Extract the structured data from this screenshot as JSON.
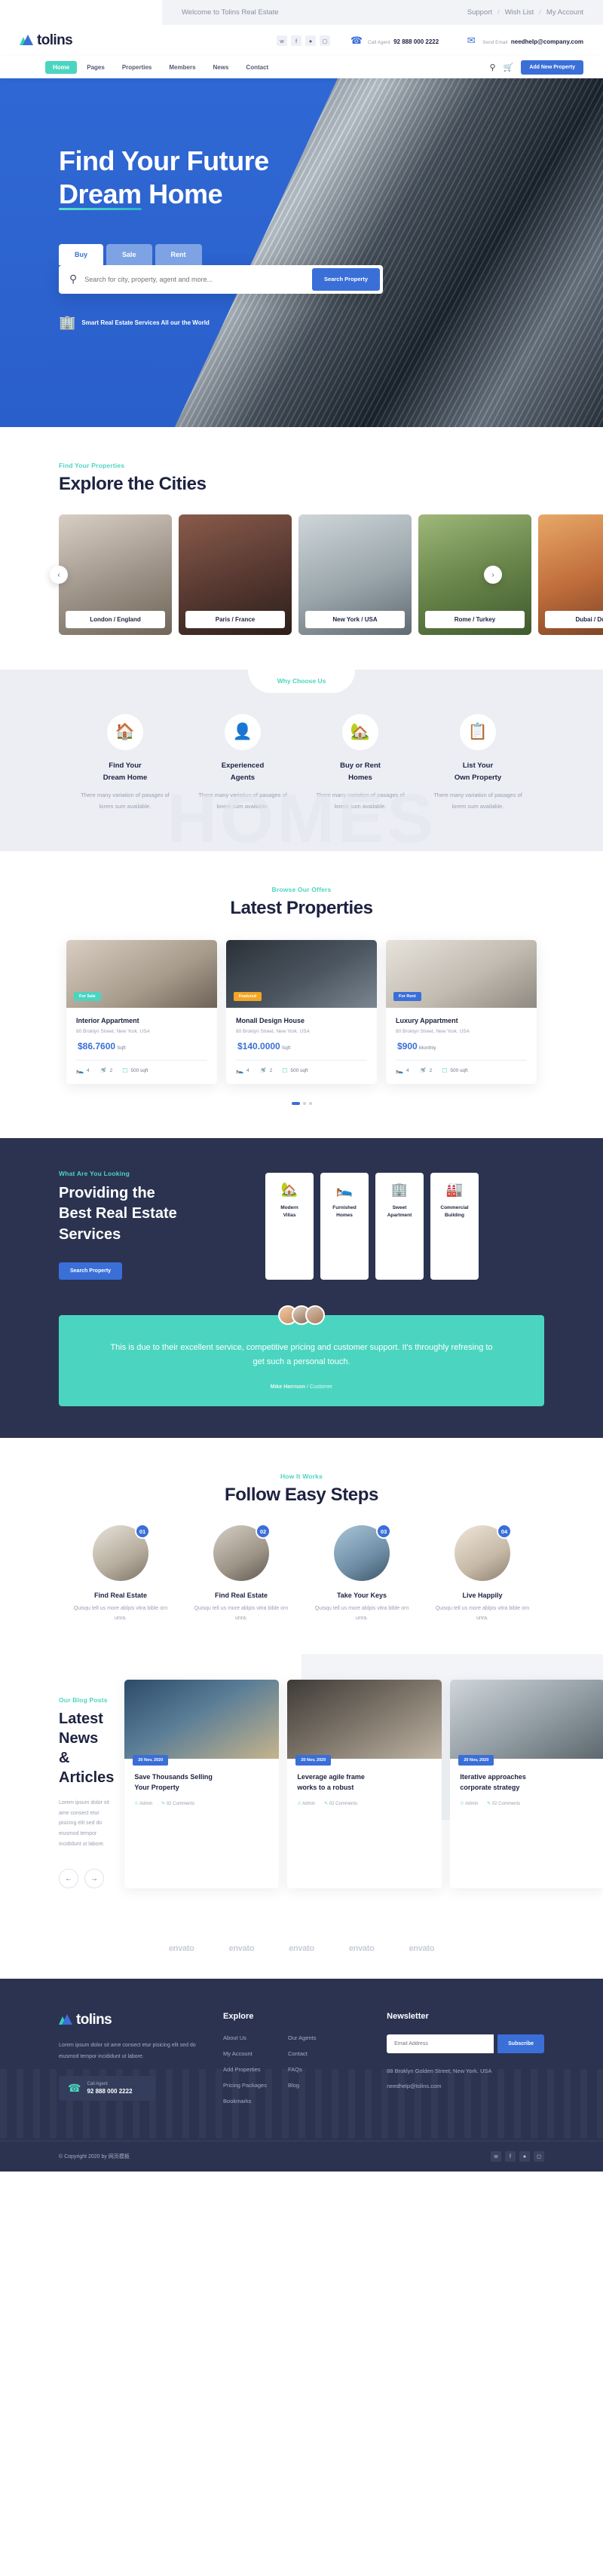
{
  "topbar": {
    "welcome": "Welcome to Tolins Real Estate",
    "support": "Support",
    "wishlist": "Wish List",
    "account": "My Account",
    "sep": "/"
  },
  "brand": {
    "name": "tolins"
  },
  "contact": {
    "call_label": "Call Agent",
    "call_value": "92 888 000 2222",
    "email_label": "Send Email",
    "email_value": "needhelp@company.com"
  },
  "social": [
    "twitter-icon",
    "facebook-icon",
    "dribbble-icon",
    "instagram-icon"
  ],
  "nav": {
    "items": [
      {
        "label": "Home",
        "active": true
      },
      {
        "label": "Pages",
        "active": false
      },
      {
        "label": "Properties",
        "active": false
      },
      {
        "label": "Members",
        "active": false
      },
      {
        "label": "News",
        "active": false
      },
      {
        "label": "Contact",
        "active": false
      }
    ],
    "cta": "Add New Property"
  },
  "hero": {
    "line1": "Find Your Future",
    "line2_underlined": "Dream",
    "line2_rest": " Home",
    "tabs": [
      {
        "label": "Buy",
        "active": true
      },
      {
        "label": "Sale",
        "active": false
      },
      {
        "label": "Rent",
        "active": false
      }
    ],
    "search_placeholder": "Search for city, property, agent and more...",
    "search_button": "Search Property",
    "note": "Smart Real Estate Services All our the World"
  },
  "cities": {
    "eyebrow": "Find Your Properties",
    "title": "Explore the Cities",
    "items": [
      {
        "label": "London / England"
      },
      {
        "label": "Paris / France"
      },
      {
        "label": "New York / USA"
      },
      {
        "label": "Rome / Turkey"
      },
      {
        "label": "Dubai / Dubai"
      }
    ]
  },
  "why": {
    "pill": "Why Choose Us",
    "ghost": "HOMES",
    "items": [
      {
        "title_l1": "Find Your",
        "title_l2": "Dream Home",
        "desc": "There many variation of pasages of lorem sum available.",
        "icon": "home-search-icon"
      },
      {
        "title_l1": "Experienced",
        "title_l2": "Agents",
        "desc": "There many variation of pasages of lorem sum available.",
        "icon": "agent-icon"
      },
      {
        "title_l1": "Buy or Rent",
        "title_l2": "Homes",
        "desc": "There many variation of pasages of lorem sum available.",
        "icon": "hand-home-icon"
      },
      {
        "title_l1": "List Your",
        "title_l2": "Own Property",
        "desc": "There many variation of pasages of lorem sum available.",
        "icon": "list-property-icon"
      }
    ]
  },
  "properties": {
    "eyebrow": "Browse Our Offers",
    "title": "Latest Properties",
    "items": [
      {
        "name": "Interior Appartment",
        "address": "80 Broklyn Street, New York. USA",
        "price": "$86.7600",
        "price_unit": "Sqft",
        "tag": "For Sale",
        "beds": "4",
        "baths": "2",
        "area": "500 sqft"
      },
      {
        "name": "Monall Design House",
        "address": "80 Broklyn Street, New York. USA",
        "price": "$140.0000",
        "price_unit": "Sqft",
        "tag": "Featured",
        "beds": "4",
        "baths": "2",
        "area": "500 sqft"
      },
      {
        "name": "Luxury Appartment",
        "address": "80 Broklyn Street, New York. USA",
        "price": "$900",
        "price_unit": "Monthly",
        "tag": "For Rent",
        "beds": "4",
        "baths": "2",
        "area": "500 sqft"
      }
    ]
  },
  "services": {
    "eyebrow": "What Are You Looking",
    "title_l1": "Providing the",
    "title_l2": "Best Real Estate",
    "title_l3": "Services",
    "button": "Search Property",
    "cards": [
      {
        "label_l1": "Modern",
        "label_l2": "Villas",
        "icon": "villa-icon"
      },
      {
        "label_l1": "Furnished",
        "label_l2": "Homes",
        "icon": "furnished-home-icon"
      },
      {
        "label_l1": "Sweet",
        "label_l2": "Apartment",
        "icon": "apartment-icon"
      },
      {
        "label_l1": "Commercial",
        "label_l2": "Building",
        "icon": "commercial-building-icon"
      }
    ],
    "quote": "This is due to their excellent service, competitive pricing and customer support. It's throughly refresing to get such a personal touch.",
    "quote_author": "Mike Harrison",
    "quote_role": "/ Customer"
  },
  "steps": {
    "eyebrow": "How It Works",
    "title": "Follow Easy Steps",
    "items": [
      {
        "num": "01",
        "title": "Find Real Estate",
        "desc": "Quisqu tell us more ablpis vitra bible orn unra."
      },
      {
        "num": "02",
        "title": "Find Real Estate",
        "desc": "Quisqu tell us more ablpis vitra bible orn unra."
      },
      {
        "num": "03",
        "title": "Take Your Keys",
        "desc": "Quisqu tell us more ablpis vitra bible orn unra."
      },
      {
        "num": "04",
        "title": "Live Happily",
        "desc": "Quisqu tell us more ablpis vitra bible orn unra."
      }
    ]
  },
  "news": {
    "eyebrow": "Our Blog Posts",
    "title_l1": "Latest News",
    "title_l2": "& Articles",
    "desc": "Lorem ipsum dolor sit ame consect etur pisicing elit sed do eiusmod tempor incididunt ut labore.",
    "items": [
      {
        "date": "20 Nov, 2020",
        "title_l1": "Save Thousands Selling",
        "title_l2": "Your Property",
        "author": "Admin",
        "comments": "02 Comments"
      },
      {
        "date": "20 Nov, 2020",
        "title_l1": "Leverage agile frame",
        "title_l2": "works to a robust",
        "author": "Admin",
        "comments": "02 Comments"
      },
      {
        "date": "20 Nov, 2020",
        "title_l1": "Iterative approaches",
        "title_l2": "corporate strategy",
        "author": "Admin",
        "comments": "02 Comments"
      }
    ]
  },
  "brands": [
    "envato",
    "envato",
    "envato",
    "envato",
    "envato"
  ],
  "footer": {
    "about": "Lorem ipsum dolor sit ame consect etur pisicing elit sed do eiusmod tempor incididunt ut labore.",
    "call_label": "Call Agent",
    "call_value": "92 888 000 2222",
    "explore_heading": "Explore",
    "explore_col1": [
      "About Us",
      "My Account",
      "Add Properties",
      "Pricing Packages",
      "Bookmarks"
    ],
    "explore_col2": [
      "Our Agents",
      "Contact",
      "FAQs",
      "Blog"
    ],
    "newsletter_heading": "Newsletter",
    "email_placeholder": "Email Address",
    "subscribe": "Subscribe",
    "address": "88 Broklyn Golden Street, New York. USA",
    "email": "needhelp@tolins.com",
    "copyright": "© Copyright 2020 by 网页模板"
  }
}
